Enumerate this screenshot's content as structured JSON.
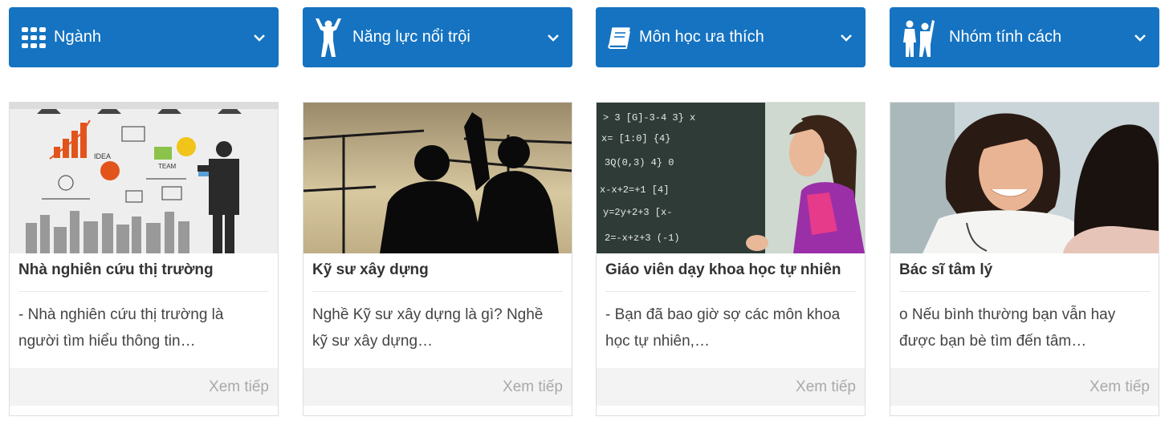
{
  "filters": [
    {
      "label": "Ngành",
      "icon": "grid-icon"
    },
    {
      "label": "Năng lực nổi trội",
      "icon": "strongman-icon"
    },
    {
      "label": "Môn học ưa thích",
      "icon": "book-icon"
    },
    {
      "label": "Nhóm tính cách",
      "icon": "people-icon"
    }
  ],
  "cards": [
    {
      "title": "Nhà nghiên cứu thị trường",
      "desc": " - Nhà nghiên cứu thị trường là\nngười tìm hiểu thông tin…",
      "more": "Xem tiếp",
      "image": "businessman-whiteboard-image"
    },
    {
      "title": "Kỹ sư xây dựng",
      "desc": "Nghề Kỹ sư xây dựng là gì? Nghề\nkỹ sư xây dựng…",
      "more": "Xem tiếp",
      "image": "construction-silhouette-image"
    },
    {
      "title": "Giáo viên dạy khoa học tự nhiên",
      "desc": " - Bạn đã bao giờ sợ các môn khoa\nhọc tự nhiên,…",
      "more": "Xem tiếp",
      "image": "teacher-chalkboard-image"
    },
    {
      "title": "Bác sĩ tâm lý",
      "desc": "o Nếu bình thường bạn vẫn hay\nđược bạn bè tìm đến tâm…",
      "more": "Xem tiếp",
      "image": "doctor-patient-image"
    }
  ],
  "colors": {
    "accent": "#1573c1",
    "footer_bg": "#f3f3f3",
    "more_text": "#a9a9a9"
  }
}
